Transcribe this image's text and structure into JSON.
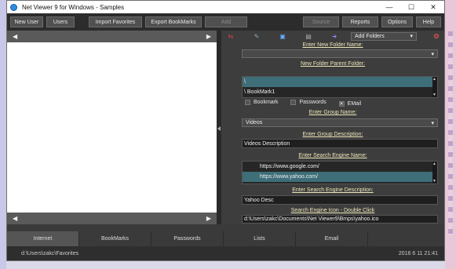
{
  "window": {
    "title": "Net Viewer 9 for Windows - Samples",
    "minimize": "—",
    "maximize": "☐",
    "close": "✕"
  },
  "toolbar": {
    "new_user": "New User",
    "users": "Users",
    "import_favorites": "Import Favorites",
    "export_bookmarks": "Export BookMarks",
    "add": "Add",
    "source": "Source",
    "reports": "Reports",
    "options": "Options",
    "help": "Help"
  },
  "nav": {
    "left_arrow": "◀",
    "right_arrow": "▶"
  },
  "right": {
    "add_folders_select": "Add Folders",
    "new_folder_name_label": "Enter New Folder Name:",
    "new_folder_name_value": "",
    "parent_folder_label": "New Folder Parent Folder:",
    "parent_items": [
      "\\",
      "\\ BookMark1"
    ],
    "checkboxes": {
      "bookmark": "Bookmark",
      "passwords": "Passwords",
      "email": "EMail",
      "email_mark": "✕"
    },
    "group_name_label": "Enter Group Name:",
    "group_name_value": "Videos",
    "group_desc_label": "Enter Group Description:",
    "group_desc_value": "Videos Description",
    "search_engine_label": "Enter Search Engine Name:",
    "search_engines": [
      "https://www.google.com/",
      "https://www.yahoo.com/"
    ],
    "search_desc_label": "Enter Search Engine Description:",
    "search_desc_value": "Yahoo Desc",
    "search_icon_label": "Search Engine Icon - Double Click",
    "search_icon_value": "d:\\Users\\zakc\\Documents\\Net Viewer9\\Bmps\\yahoo.ico"
  },
  "tabs": [
    "Internet",
    "BookMarks",
    "Passwords",
    "Lists",
    "Email"
  ],
  "status": {
    "path": "d:\\Users\\zakc\\Favorites",
    "datetime": "2016 6 11 21:41"
  },
  "colors": {
    "label": "#ece6b8",
    "selected_row": "#3e6e78"
  }
}
